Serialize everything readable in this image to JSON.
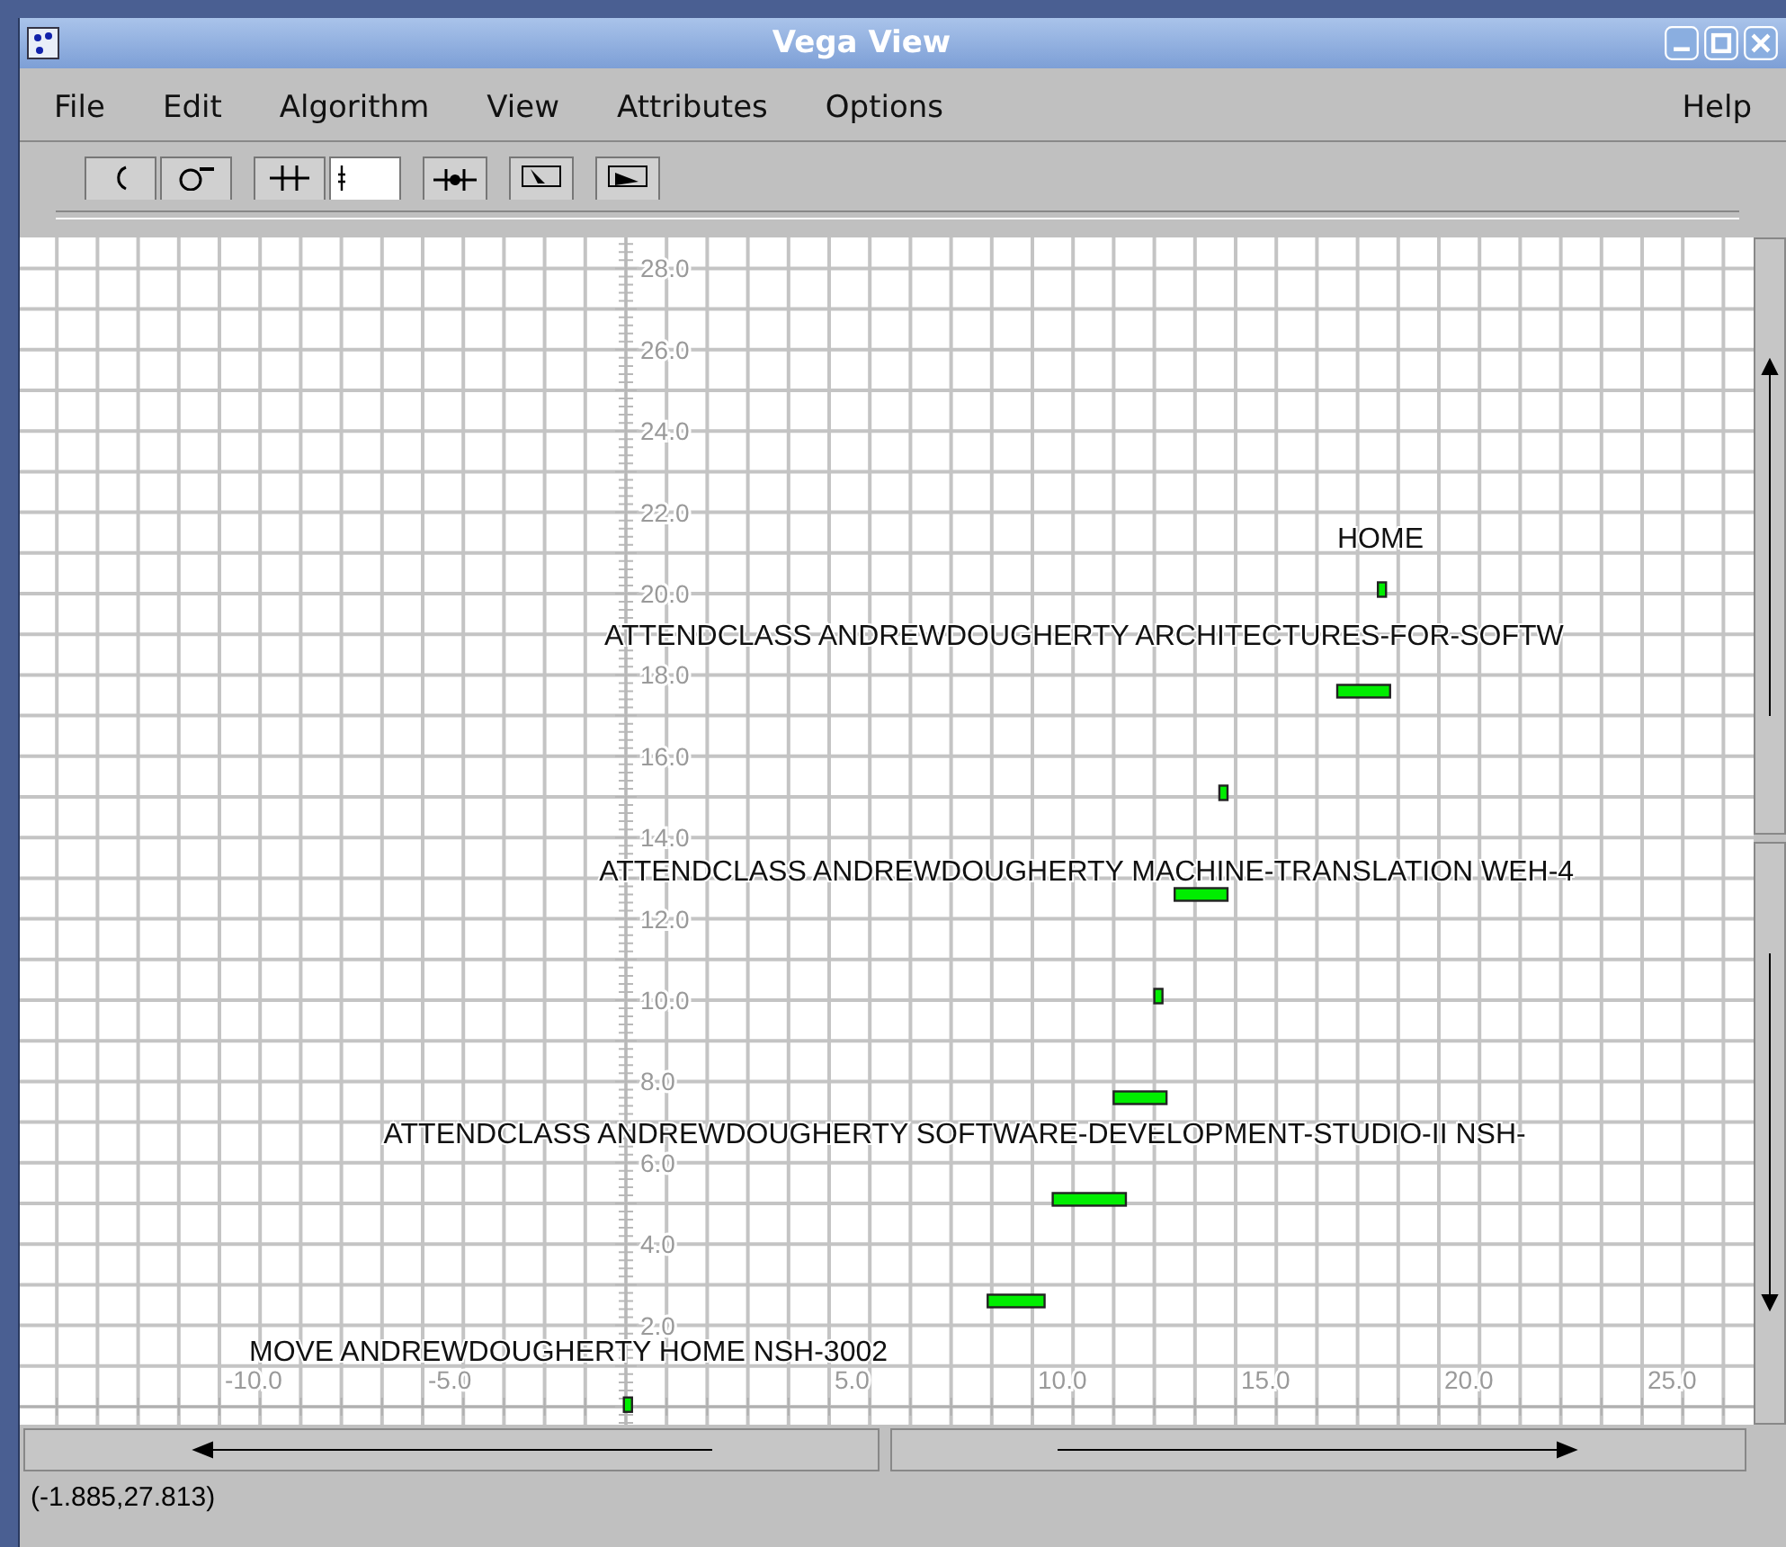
{
  "window": {
    "title": "Vega View"
  },
  "menu": {
    "items": [
      {
        "label": "File"
      },
      {
        "label": "Edit"
      },
      {
        "label": "Algorithm"
      },
      {
        "label": "View"
      },
      {
        "label": "Attributes"
      },
      {
        "label": "Options"
      }
    ],
    "right_items": [
      {
        "label": "Help"
      }
    ]
  },
  "toolbar": [
    {
      "buttons": [
        {
          "kind": "curve"
        },
        {
          "kind": "circle"
        }
      ]
    },
    {
      "buttons": [
        {
          "kind": "grid"
        },
        {
          "kind": "ruler"
        }
      ]
    },
    {
      "buttons": [
        {
          "kind": "cross"
        }
      ]
    },
    {
      "buttons": [
        {
          "kind": "pointer"
        }
      ]
    },
    {
      "buttons": [
        {
          "kind": "play"
        }
      ]
    }
  ],
  "plot": {
    "x_tick_labels": [
      "-10.0",
      "-5.0",
      "5.0",
      "10.0",
      "15.0",
      "20.0",
      "25.0"
    ],
    "y_tick_labels": [
      "28.0",
      "26.0",
      "24.0",
      "22.0",
      "20.0",
      "18.0",
      "16.0",
      "14.0",
      "12.0",
      "10.0",
      "8.0",
      "6.0",
      "4.0",
      "2.0"
    ],
    "labels": [
      {
        "text": "HOME"
      },
      {
        "text": "ATTENDCLASS ANDREWDOUGHERTY ARCHITECTURES-FOR-SOFTW"
      },
      {
        "text": "ATTENDCLASS ANDREWDOUGHERTY MACHINE-TRANSLATION WEH-4"
      },
      {
        "text": "ATTENDCLASS ANDREWDOUGHERTY SOFTWARE-DEVELOPMENT-STUDIO-II NSH-"
      },
      {
        "text": "MOVE ANDREWDOUGHERTY HOME NSH-3002"
      }
    ]
  },
  "status_bar": {
    "text": "(-1.885,27.813)"
  }
}
